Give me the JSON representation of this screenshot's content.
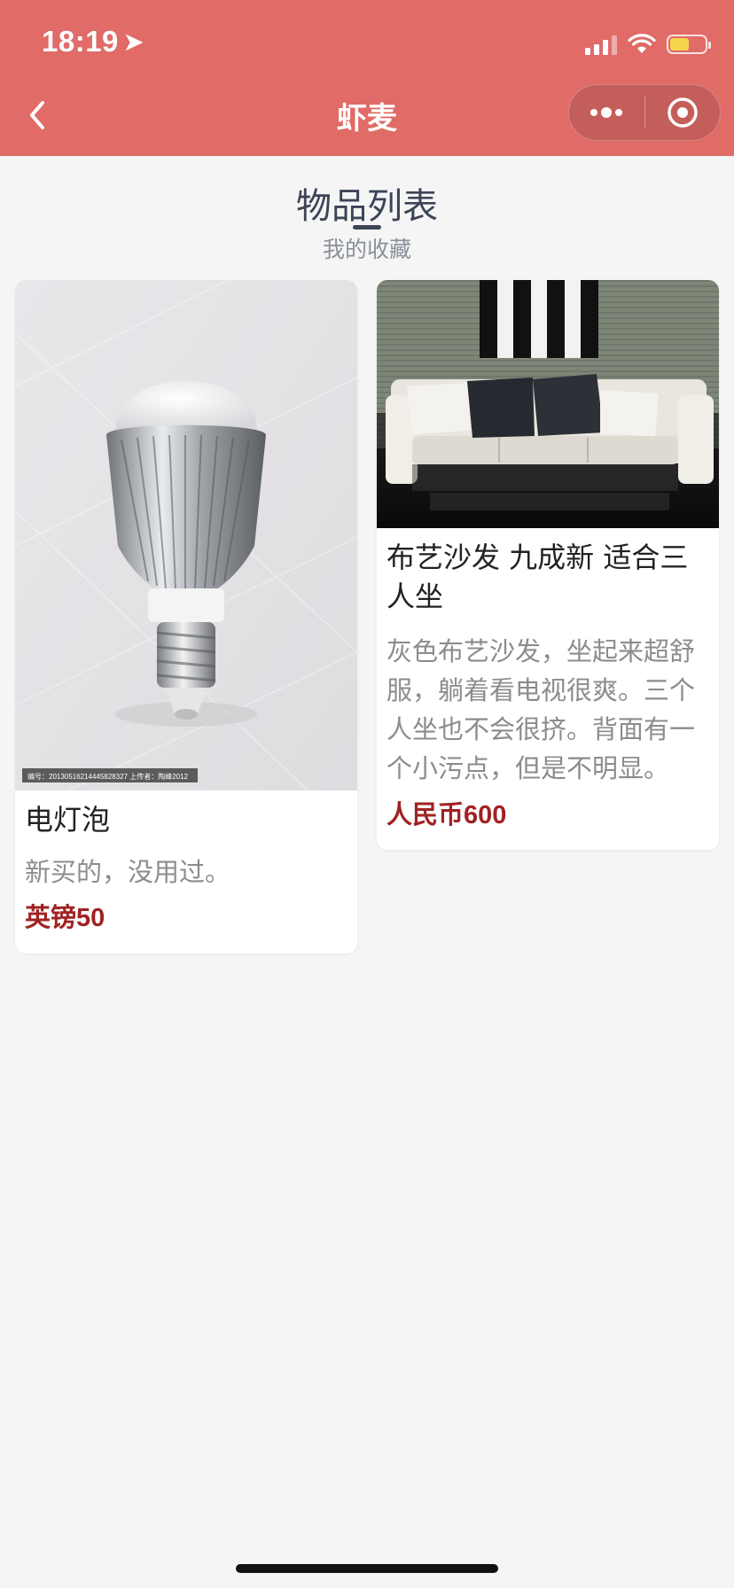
{
  "status_bar": {
    "time": "18:19",
    "location_glyph": "➤",
    "battery_level": 0.55,
    "battery_color": "#f5d64a"
  },
  "nav": {
    "title": "虾麦",
    "background_color": "#e06b67"
  },
  "section": {
    "title": "物品列表",
    "subtitle": "我的收藏"
  },
  "items": [
    {
      "name": "电灯泡",
      "description": "新买的，没用过。",
      "price": "英镑50",
      "image_caption": "编号：20130516214445828327 上传者：陶峰2012"
    },
    {
      "name": "布艺沙发 九成新 适合三人坐",
      "description": "灰色布艺沙发，坐起来超舒服，躺着看电视很爽。三个人坐也不会很挤。背面有一个小污点，但是不明显。",
      "price": "人民币600"
    }
  ],
  "colors": {
    "price": "#a02222",
    "title": "#3d4457",
    "page_background": "#f5f5f5"
  }
}
